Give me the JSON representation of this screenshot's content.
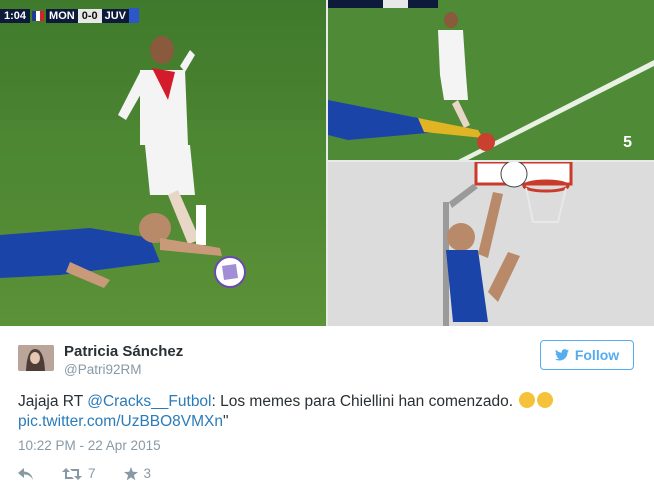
{
  "media": {
    "scoreboard": {
      "time": "1:04",
      "home": "MON",
      "score": "0-0",
      "away": "JUV"
    },
    "watermark": "5"
  },
  "tweet": {
    "author_name": "Patricia Sánchez",
    "author_handle": "@Patri92RM",
    "follow_label": "Follow",
    "text_prefix": "Jajaja RT ",
    "mention": "@Cracks__Futbol",
    "text_body": ": Los memes para Chiellini han comenzado. ",
    "pic_link": "pic.twitter.com/UzBBO8VMXn",
    "pic_suffix": "\"",
    "timestamp": "10:22 PM - 22 Apr 2015",
    "retweet_count": "7",
    "favorite_count": "3"
  },
  "colors": {
    "accent": "#55acee",
    "link": "#2b7bb9",
    "muted": "#8899a6"
  },
  "icons": [
    "reply-icon",
    "retweet-icon",
    "favorite-star-icon",
    "twitter-bird-icon",
    "joy-emoji-icon"
  ]
}
